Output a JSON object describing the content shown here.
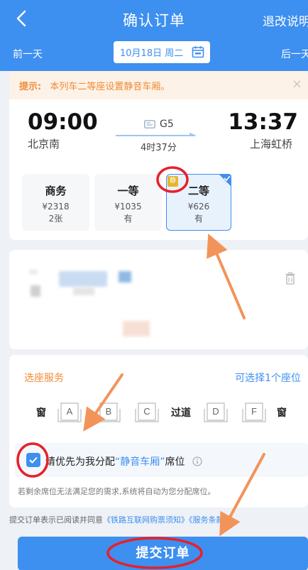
{
  "nav": {
    "title": "确认订单",
    "refund_label": "退改说明"
  },
  "datebar": {
    "prev_label": "前一天",
    "next_label": "后一天",
    "date": "10月18日 周二"
  },
  "tip": {
    "prefix": "提示:",
    "message": "本列车二等座设置静音车厢。"
  },
  "train": {
    "departure_time": "09:00",
    "departure_station": "北京南",
    "arrival_time": "13:37",
    "arrival_station": "上海虹桥",
    "number": "G5",
    "duration": "4时37分"
  },
  "seats": [
    {
      "name": "商务",
      "price": "¥2318",
      "availability": "2张"
    },
    {
      "name": "一等",
      "price": "¥1035",
      "availability": "有"
    },
    {
      "name": "二等",
      "price": "¥626",
      "availability": "有"
    }
  ],
  "quiet_badge": "静",
  "seat_service": {
    "title": "选座服务",
    "count_hint": "可选择1个座位",
    "window_label": "窗",
    "aisle_label": "过道",
    "letters": [
      "A",
      "B",
      "C",
      "D",
      "F"
    ]
  },
  "preference": {
    "text_before": "请优先为我分配",
    "highlight": "“静音车厢”",
    "text_after": "席位",
    "note": "若剩余席位无法满足您的需求,系统将自动为您分配席位。"
  },
  "agreement": {
    "prefix": "提交订单表示已阅读并同意",
    "link1": "《铁路互联网购票须知》",
    "link2": "《服务条款》"
  },
  "submit_label": "提交订单",
  "colors": {
    "primary": "#3d8ff0",
    "accent_orange": "#f08c38",
    "annotation_red": "#e8202a",
    "annotation_arrow": "#f2945a"
  }
}
